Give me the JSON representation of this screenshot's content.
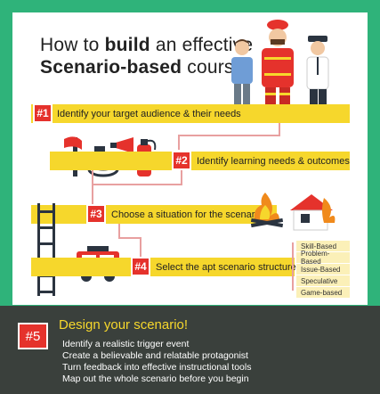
{
  "title": {
    "line1_prefix": "How to",
    "line1_bold": "build",
    "line1_suffix": "an effective",
    "line2_bold": "Scenario-based",
    "line2_suffix": "course"
  },
  "steps": [
    {
      "badge": "#1",
      "label": "Identify your target audience & their needs"
    },
    {
      "badge": "#2",
      "label": "Identify learning needs & outcomes"
    },
    {
      "badge": "#3",
      "label": "Choose a situation for the scenario"
    },
    {
      "badge": "#4",
      "label": "Select the apt scenario structure"
    }
  ],
  "structures": [
    "Skill-Based",
    "Problem-Based",
    "Issue-Based",
    "Speculative",
    "Game-based"
  ],
  "final": {
    "badge": "#5",
    "title": "Design your scenario!",
    "items": [
      "Identify a realistic trigger event",
      "Create a believable and relatable protagonist",
      "Turn feedback into effective instructional tools",
      "Map out the whole scenario before you begin"
    ]
  },
  "colors": {
    "background": "#2fb37a",
    "band": "#f6d72c",
    "badge": "#e5322c",
    "dark_panel": "#3a403c"
  },
  "icons": [
    "firefighter-icon",
    "person-blue-shirt-icon",
    "police-officer-icon",
    "fire-axe-icon",
    "fire-hose-icon",
    "megaphone-icon",
    "fire-extinguisher-icon",
    "campfire-icon",
    "burning-house-icon",
    "ladder-icon",
    "fire-truck-icon"
  ]
}
